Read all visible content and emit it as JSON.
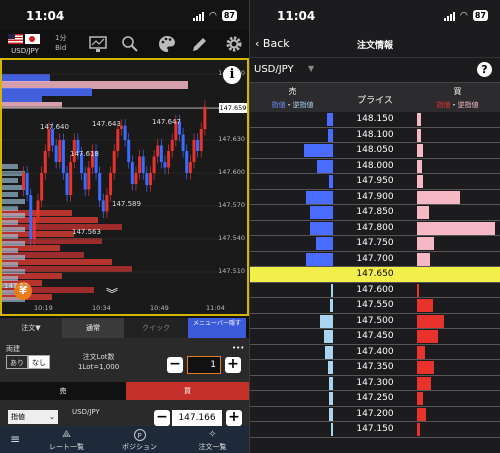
{
  "left_screen": {
    "status": {
      "time": "11:04",
      "battery": "87"
    },
    "toolbar": {
      "pair": "USD/JPY",
      "timeframe": "1分",
      "side": "Bid"
    },
    "chart_data": {
      "type": "candlestick",
      "y_ticks": [
        147.69,
        147.659,
        147.63,
        147.6,
        147.57,
        147.54,
        147.51
      ],
      "y_tick_labels": [
        "147.690",
        "147.659",
        "147.630",
        "147.600",
        "147.570",
        "147.540",
        "147.510"
      ],
      "current_price": "147.659",
      "annotations": [
        "147.640",
        "147.643",
        "147.647",
        "147.618",
        "147.589",
        "147.563",
        "147.51"
      ],
      "x_labels": [
        "10:19",
        "10:34",
        "10:49",
        "11:04"
      ]
    },
    "order_tabs": [
      "注文▼",
      "通常",
      "クイック",
      "メニューバー隠す"
    ],
    "order": {
      "label_both": "両建",
      "yes": "あり",
      "no": "なし",
      "lot_label": "注文Lot数",
      "lot_size": "1Lot=1,000",
      "qty": "1",
      "more": "•••",
      "sell": "売",
      "buy": "買",
      "order_type": "指値",
      "symbol": "USD/JPY",
      "price": "147.166"
    },
    "bottom_nav": [
      "レート一覧",
      "ポジション",
      "注文一覧"
    ]
  },
  "right_screen": {
    "status": {
      "time": "11:04",
      "battery": "87"
    },
    "nav": {
      "back": "Back",
      "title": "注文情報"
    },
    "symbol": "USD/JPY",
    "header": {
      "sell": "売",
      "sell_sub_limit": "指値",
      "sell_sub_dot": "・",
      "sell_sub_stop": "逆指値",
      "price": "プライス",
      "buy": "買",
      "buy_sub_limit": "指値",
      "buy_sub_dot": "・",
      "buy_sub_stop": "逆指値"
    },
    "rows": [
      {
        "price": "148.150",
        "sell": 0.08,
        "buy": 0.05
      },
      {
        "price": "148.100",
        "sell": 0.07,
        "buy": 0.05
      },
      {
        "price": "148.050",
        "sell": 0.37,
        "buy": 0.08
      },
      {
        "price": "148.000",
        "sell": 0.2,
        "buy": 0.07
      },
      {
        "price": "147.950",
        "sell": 0.05,
        "buy": 0.08
      },
      {
        "price": "147.900",
        "sell": 0.35,
        "buy": 0.55
      },
      {
        "price": "147.850",
        "sell": 0.3,
        "buy": 0.15
      },
      {
        "price": "147.800",
        "sell": 0.3,
        "buy": 1.0
      },
      {
        "price": "147.750",
        "sell": 0.22,
        "buy": 0.22
      },
      {
        "price": "147.700",
        "sell": 0.35,
        "buy": 0.17
      },
      {
        "price": "147.650",
        "sell": 0,
        "buy": 0,
        "current": true
      },
      {
        "price": "147.600",
        "sell": 0.03,
        "buy": 0.02
      },
      {
        "price": "147.550",
        "sell": 0.04,
        "buy": 0.2
      },
      {
        "price": "147.500",
        "sell": 0.17,
        "buy": 0.35
      },
      {
        "price": "147.450",
        "sell": 0.12,
        "buy": 0.27
      },
      {
        "price": "147.400",
        "sell": 0.1,
        "buy": 0.1
      },
      {
        "price": "147.350",
        "sell": 0.07,
        "buy": 0.22
      },
      {
        "price": "147.300",
        "sell": 0.05,
        "buy": 0.18
      },
      {
        "price": "147.250",
        "sell": 0.05,
        "buy": 0.08
      },
      {
        "price": "147.200",
        "sell": 0.05,
        "buy": 0.12
      },
      {
        "price": "147.150",
        "sell": 0.03,
        "buy": 0.04
      }
    ],
    "colors": {
      "sell_above": "#4a6cff",
      "buy_above": "#f7b8c6",
      "sell_below": "#a9d4ef",
      "buy_below": "#e8322c",
      "current": "#f2ee4a"
    }
  }
}
